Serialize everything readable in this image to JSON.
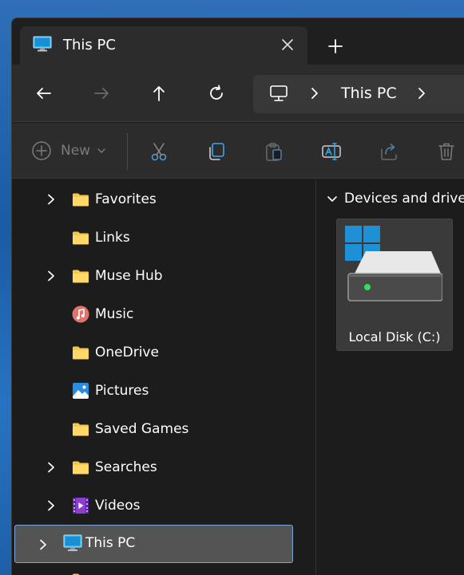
{
  "window": {
    "tab_title": "This PC",
    "tab_icon": "monitor-icon",
    "close_icon": "close-icon",
    "new_tab_icon": "plus-icon"
  },
  "nav": {
    "buttons": [
      "back-arrow-icon",
      "forward-arrow-icon",
      "up-arrow-icon",
      "refresh-icon"
    ],
    "address": {
      "location_icon": "monitor-icon",
      "crumb": "This PC"
    }
  },
  "toolbar": {
    "new_label": "New",
    "buttons": [
      "cut-icon",
      "copy-icon",
      "paste-icon",
      "rename-icon",
      "share-icon",
      "delete-icon"
    ]
  },
  "sidebar": {
    "items": [
      {
        "label": "Favorites",
        "icon": "folder-icon",
        "expandable": true
      },
      {
        "label": "Links",
        "icon": "folder-icon",
        "expandable": false
      },
      {
        "label": "Muse Hub",
        "icon": "folder-icon",
        "expandable": true
      },
      {
        "label": "Music",
        "icon": "music-icon",
        "expandable": false
      },
      {
        "label": "OneDrive",
        "icon": "folder-icon",
        "expandable": false
      },
      {
        "label": "Pictures",
        "icon": "pictures-icon",
        "expandable": false
      },
      {
        "label": "Saved Games",
        "icon": "folder-icon",
        "expandable": false
      },
      {
        "label": "Searches",
        "icon": "folder-icon",
        "expandable": true
      },
      {
        "label": "Videos",
        "icon": "videos-icon",
        "expandable": true
      },
      {
        "label": "This PC",
        "icon": "monitor-icon",
        "expandable": true,
        "selected": true
      }
    ]
  },
  "main": {
    "group_label": "Devices and drives",
    "drives": [
      {
        "label": "Local Disk (C:)",
        "icon": "hard-drive-icon"
      }
    ]
  },
  "colors": {
    "window_bg": "#1c1c1c",
    "bar_bg": "#2c2c2c",
    "folder_yellow": "#f7c64a",
    "accent_blue": "#1e90d6",
    "selection_border": "#7aa6d6"
  }
}
